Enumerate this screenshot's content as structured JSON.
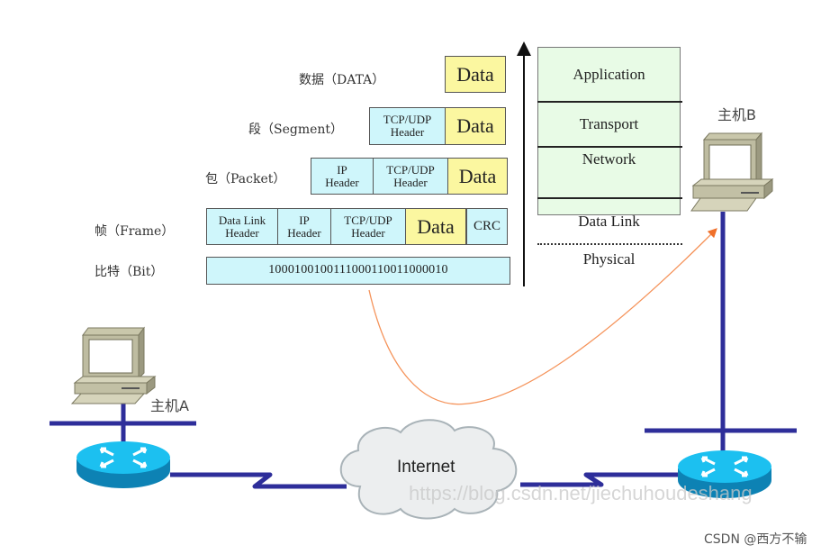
{
  "encapsulation": {
    "rows": [
      {
        "label": "数据（DATA）",
        "cells": [
          "Data"
        ]
      },
      {
        "label": "段（Segment）",
        "cells": [
          "TCP/UDP\nHeader",
          "Data"
        ]
      },
      {
        "label": "包（Packet）",
        "cells": [
          "IP\nHeader",
          "TCP/UDP\nHeader",
          "Data"
        ]
      },
      {
        "label": "帧（Frame）",
        "cells": [
          "Data Link\nHeader",
          "IP\nHeader",
          "TCP/UDP\nHeader",
          "Data",
          "CRC"
        ]
      },
      {
        "label": "比特（Bit）",
        "cells": [
          "1000100100111000110011000010"
        ]
      }
    ]
  },
  "stack": {
    "layers": [
      "Application",
      "Transport",
      "Network",
      "Data Link",
      "Physical"
    ]
  },
  "network": {
    "host_a": "主机A",
    "host_b": "主机B",
    "cloud": "Internet"
  },
  "watermark": "https://blog.csdn.net/jiechuhoudeshang",
  "credit": "CSDN @西方不输",
  "colors": {
    "header_fill": "#cff6fb",
    "data_fill": "#fbf7a0",
    "stack_fill": "#e8fbe6",
    "link_line": "#2e2e9a",
    "router": "#1ba6dc",
    "flow_arrow": "#f5935a"
  }
}
